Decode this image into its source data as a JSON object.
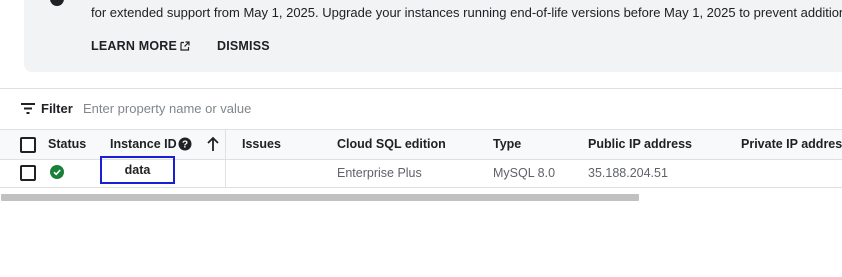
{
  "banner": {
    "text": "for extended support from May 1, 2025. Upgrade your instances running end-of-life versions before May 1, 2025 to prevent additional",
    "learn_more_label": "LEARN MORE",
    "dismiss_label": "DISMISS"
  },
  "filter": {
    "label": "Filter",
    "placeholder": "Enter property name or value"
  },
  "table": {
    "columns": {
      "status": "Status",
      "instance_id": "Instance ID",
      "issues": "Issues",
      "edition": "Cloud SQL edition",
      "type": "Type",
      "public_ip": "Public IP address",
      "private_ip": "Private IP address"
    },
    "rows": [
      {
        "status": "running",
        "instance_id": "data",
        "issues": "",
        "edition": "Enterprise Plus",
        "type": "MySQL 8.0",
        "public_ip": "35.188.204.51",
        "private_ip": ""
      }
    ]
  },
  "colors": {
    "status_ok": "#188038",
    "highlight": "#1a1fd6"
  },
  "icons": {
    "banner": "info-icon",
    "external": "external-link-icon",
    "filter": "filter-list-icon",
    "help": "help-icon",
    "sort": "arrow-upward-icon",
    "status": "check-circle-icon"
  }
}
